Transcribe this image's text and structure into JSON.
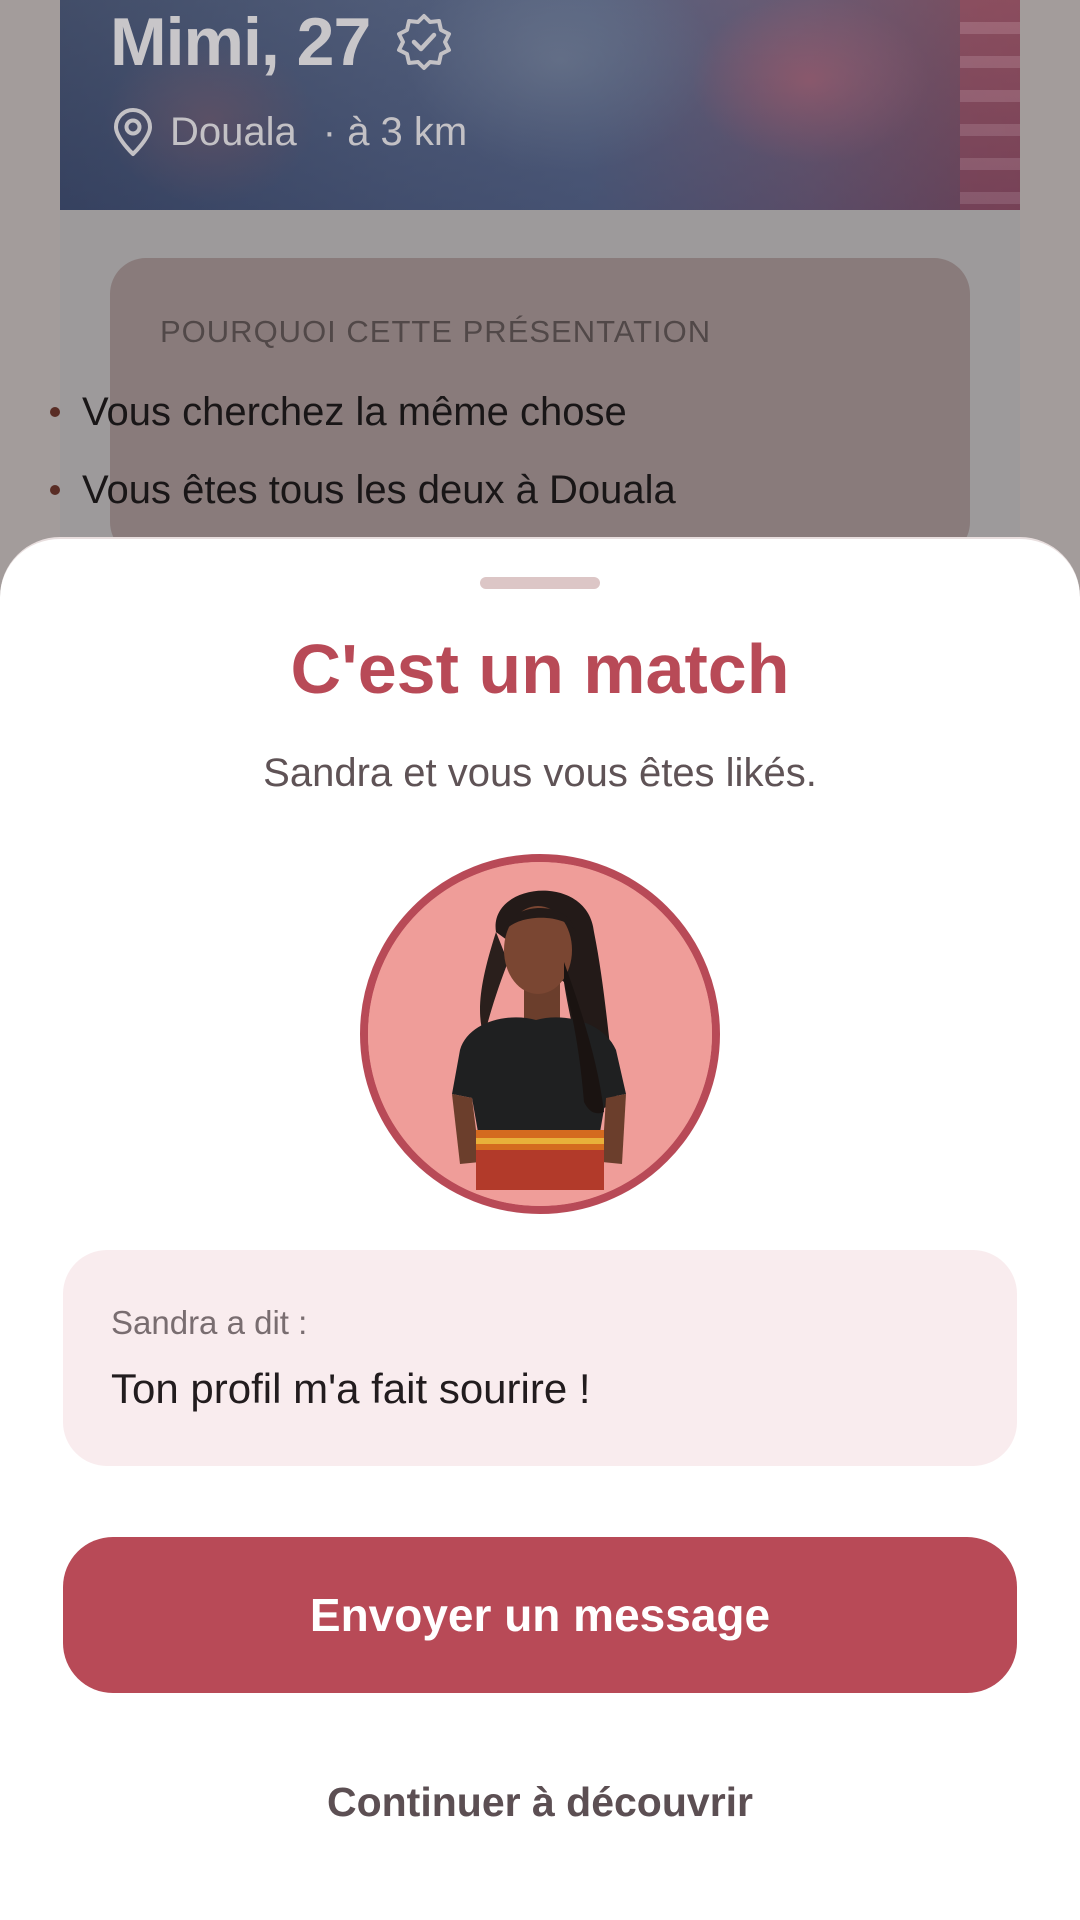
{
  "profile": {
    "name_age": "Mimi, 27",
    "verified_icon": "verified-badge-icon",
    "location_icon": "location-pin-icon",
    "city": "Douala",
    "distance": "· à 3 km",
    "reasons_title": "POURQUOI CETTE PRÉSENTATION",
    "reasons": [
      "Vous cherchez la même chose",
      "Vous êtes tous les deux à Douala"
    ]
  },
  "match": {
    "title": "C'est un match",
    "subtitle": "Sandra et vous vous êtes likés.",
    "quote_author": "Sandra a dit :",
    "quote_text": "Ton profil m'a fait sourire !",
    "primary_button": "Envoyer un message",
    "secondary_button": "Continuer à découvrir"
  },
  "colors": {
    "accent": "#b84a57",
    "quote_background": "#f9ecee",
    "overlay_card": "#897b7b"
  }
}
